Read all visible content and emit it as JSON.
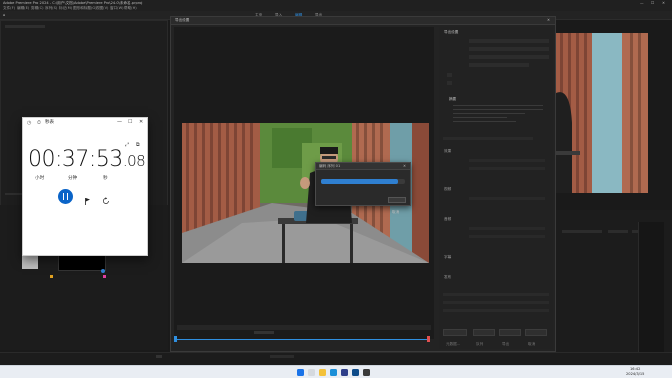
{
  "window": {
    "title": "Adobe Premiere Pro 2024 - C:\\用户\\文档\\Adobe\\Premiere Pro\\24.0\\未命名.prproj",
    "menus": [
      "文件(F)",
      "编辑(E)",
      "剪辑(C)",
      "序列(S)",
      "标记(M)",
      "图形和标题(G)",
      "视图(V)",
      "窗口(W)",
      "帮助(H)"
    ]
  },
  "workspace": {
    "tabs": [
      "主页",
      "导入",
      "编辑",
      "导出"
    ]
  },
  "export_dialog": {
    "title": "导出设置",
    "section_headers": [
      "导出设置",
      "摘要",
      "效果",
      "视频",
      "音频",
      "字幕",
      "发布"
    ],
    "summary_label": "摘要",
    "buttons": [
      "元数据...",
      "队列",
      "导出",
      "取消"
    ]
  },
  "progress_popup": {
    "title": "编码 序列 01",
    "percent": 0.92,
    "cancel_label": "取消"
  },
  "clock": {
    "app_title": "秒表",
    "time_main": "00:37:53",
    "time_ms": ".08",
    "units": [
      "小时",
      "分钟",
      "秒"
    ],
    "buttons": {
      "pause": "暂停",
      "lap": "标记",
      "reset": "重置"
    }
  },
  "taskbar": {
    "time": "16:42",
    "date": "2024/3/15",
    "search_placeholder": "搜索"
  },
  "colors": {
    "accent": "#0a64c8",
    "progress": "#2f7fd0",
    "timeline": "#2f8fe0"
  }
}
